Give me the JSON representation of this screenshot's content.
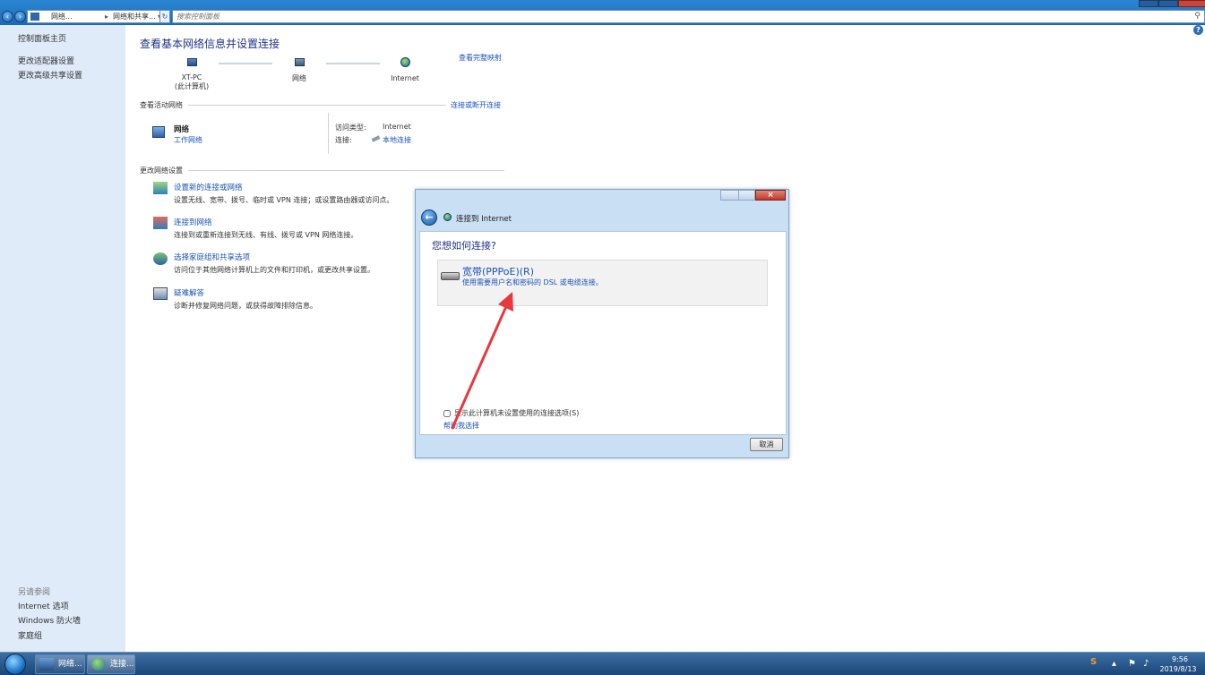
{
  "explorer": {
    "breadcrumb": [
      "网络...",
      "网络和共享..."
    ],
    "search_placeholder": "搜索控制面板"
  },
  "left_pane": {
    "links": [
      "控制面板主页",
      "更改适配器设置",
      "更改高级共享设置"
    ],
    "see_also_heading": "另请参阅",
    "see_also": [
      "Internet 选项",
      "Windows 防火墙",
      "家庭组"
    ]
  },
  "main": {
    "title": "查看基本网络信息并设置连接",
    "view_full_map": "查看完整映射",
    "map_nodes": [
      {
        "label": "XT-PC",
        "sublabel": "(此计算机)",
        "icon": "computer-icon"
      },
      {
        "label": "网络",
        "icon": "network-icon"
      },
      {
        "label": "Internet",
        "icon": "globe-icon"
      }
    ],
    "active_networks_heading": "查看活动网络",
    "connect_disconnect": "连接或断开连接",
    "network": {
      "name": "网络",
      "type_link": "工作网络",
      "access_type_label": "访问类型:",
      "access_type_value": "Internet",
      "connection_label": "连接:",
      "connection_value": "本地连接"
    },
    "change_settings_heading": "更改网络设置",
    "tasks": [
      {
        "title": "设置新的连接或网络",
        "desc": "设置无线、宽带、拨号、临时或 VPN 连接；或设置路由器或访问点。",
        "icon": "new-connection-icon"
      },
      {
        "title": "连接到网络",
        "desc": "连接到或重新连接到无线、有线、拨号或 VPN 网络连接。",
        "icon": "connect-network-icon"
      },
      {
        "title": "选择家庭组和共享选项",
        "desc": "访问位于其他网络计算机上的文件和打印机，或更改共享设置。",
        "icon": "homegroup-icon"
      },
      {
        "title": "疑难解答",
        "desc": "诊断并修复网络问题，或获得故障排除信息。",
        "icon": "troubleshoot-icon"
      }
    ]
  },
  "dialog": {
    "title": "连接到 Internet",
    "question": "您想如何连接?",
    "option_title": "宽带(PPPoE)(R)",
    "option_desc": "使用需要用户名和密码的 DSL 或电缆连接。",
    "show_options_label": "显示此计算机未设置使用的连接选项(S)",
    "show_options_checked": false,
    "help_link": "帮助我选择",
    "cancel_label": "取消"
  },
  "taskbar": {
    "items": [
      {
        "label": "网络...",
        "icon": "network-folder-icon"
      },
      {
        "label": "连接...",
        "icon": "globe-icon"
      }
    ],
    "time": "9:56",
    "date": "2019/8/13"
  },
  "colors": {
    "link": "#1a54b8",
    "title": "#1e3287",
    "annotation_arrow": "#e8383d"
  }
}
